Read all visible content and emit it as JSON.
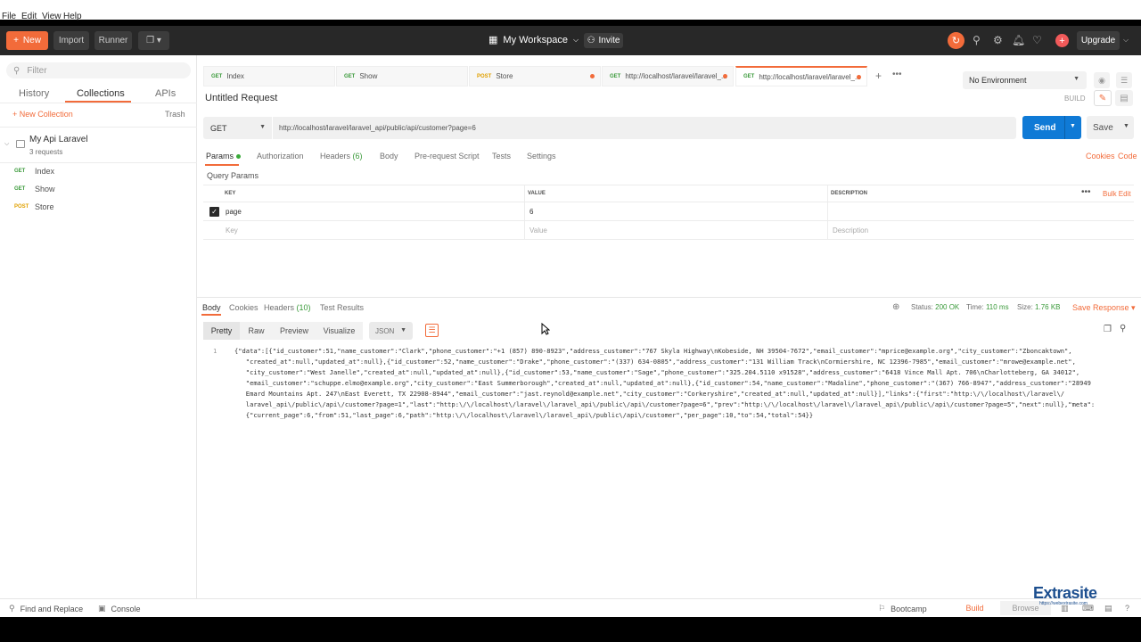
{
  "menubar": {
    "file": "File",
    "edit": "Edit",
    "view": "View",
    "help": "Help"
  },
  "topbar": {
    "new_label": "New",
    "import_label": "Import",
    "runner_label": "Runner",
    "workspace_label": "My Workspace",
    "invite_label": "Invite",
    "upgrade_label": "Upgrade"
  },
  "sidebar": {
    "filter_placeholder": "Filter",
    "tabs": [
      {
        "label": "History"
      },
      {
        "label": "Collections"
      },
      {
        "label": "APIs"
      }
    ],
    "new_collection_label": "+ New Collection",
    "trash_label": "Trash",
    "collection": {
      "name": "My Api Laravel",
      "count": "3 requests"
    },
    "requests": [
      {
        "method": "GET",
        "name": "Index"
      },
      {
        "method": "GET",
        "name": "Show"
      },
      {
        "method": "POST",
        "name": "Store"
      }
    ]
  },
  "tabs": [
    {
      "method": "GET",
      "label": "Index"
    },
    {
      "method": "GET",
      "label": "Show"
    },
    {
      "method": "POST",
      "label": "Store"
    },
    {
      "method": "GET",
      "label": "http://localhost/laravel/laravel_..."
    },
    {
      "method": "GET",
      "label": "http://localhost/laravel/laravel_..."
    }
  ],
  "environment": {
    "selected": "No Environment"
  },
  "request": {
    "title": "Untitled Request",
    "build_label": "BUILD",
    "method": "GET",
    "url": "http://localhost/laravel/laravel_api/public/api/customer?page=6",
    "send_label": "Send",
    "save_label": "Save"
  },
  "param_tabs": [
    {
      "label": "Params"
    },
    {
      "label": "Authorization"
    },
    {
      "label": "Headers",
      "count": "(6)"
    },
    {
      "label": "Body"
    },
    {
      "label": "Pre-request Script"
    },
    {
      "label": "Tests"
    },
    {
      "label": "Settings"
    }
  ],
  "links": {
    "cookies": "Cookies",
    "code": "Code"
  },
  "query_params": {
    "title": "Query Params",
    "headers": {
      "key": "KEY",
      "value": "VALUE",
      "description": "DESCRIPTION"
    },
    "bulk_edit": "Bulk Edit",
    "row": {
      "key": "page",
      "value": "6"
    },
    "placeholders": {
      "key": "Key",
      "value": "Value",
      "description": "Description"
    }
  },
  "response": {
    "tabs": [
      {
        "label": "Body"
      },
      {
        "label": "Cookies"
      },
      {
        "label": "Headers",
        "count": "(10)"
      },
      {
        "label": "Test Results"
      }
    ],
    "status_label": "Status:",
    "status_value": "200 OK",
    "time_label": "Time:",
    "time_value": "110 ms",
    "size_label": "Size:",
    "size_value": "1.76 KB",
    "save_response": "Save Response",
    "format_buttons": [
      {
        "label": "Pretty"
      },
      {
        "label": "Raw"
      },
      {
        "label": "Preview"
      },
      {
        "label": "Visualize"
      }
    ],
    "format_select": "JSON",
    "line_number": "1",
    "body_lines": [
      "{\"data\":[{\"id_customer\":51,\"name_customer\":\"Clark\",\"phone_customer\":\"+1 (857) 890-8923\",\"address_customer\":\"767 Skyla Highway\\nKobeside, NH 39504-7672\",\"email_customer\":\"mprice@example.org\",\"city_customer\":\"Zboncaktown\",",
      "   \"created_at\":null,\"updated_at\":null},{\"id_customer\":52,\"name_customer\":\"Drake\",\"phone_customer\":\"(337) 634-0805\",\"address_customer\":\"131 William Track\\nCormiershire, NC 12396-7985\",\"email_customer\":\"mrowe@example.net\",",
      "   \"city_customer\":\"West Janelle\",\"created_at\":null,\"updated_at\":null},{\"id_customer\":53,\"name_customer\":\"Sage\",\"phone_customer\":\"325.204.5110 x91528\",\"address_customer\":\"6418 Vince Mall Apt. 706\\nCharlotteberg, GA 34012\",",
      "   \"email_customer\":\"schuppe.elmo@example.org\",\"city_customer\":\"East Summerborough\",\"created_at\":null,\"updated_at\":null},{\"id_customer\":54,\"name_customer\":\"Madaline\",\"phone_customer\":\"(367) 766-8947\",\"address_customer\":\"28949",
      "   Emard Mountains Apt. 247\\nEast Everett, TX 22908-8944\",\"email_customer\":\"jast.reynold@example.net\",\"city_customer\":\"Corkeryshire\",\"created_at\":null,\"updated_at\":null}],\"links\":{\"first\":\"http:\\/\\/localhost\\/laravel\\/",
      "   laravel_api\\/public\\/api\\/customer?page=1\",\"last\":\"http:\\/\\/localhost\\/laravel\\/laravel_api\\/public\\/api\\/customer?page=6\",\"prev\":\"http:\\/\\/localhost\\/laravel\\/laravel_api\\/public\\/api\\/customer?page=5\",\"next\":null},\"meta\":",
      "   {\"current_page\":6,\"from\":51,\"last_page\":6,\"path\":\"http:\\/\\/localhost\\/laravel\\/laravel_api\\/public\\/api\\/customer\",\"per_page\":10,\"to\":54,\"total\":54}}"
    ]
  },
  "footer": {
    "find_replace": "Find and Replace",
    "console": "Console",
    "bootcamp": "Bootcamp",
    "build": "Build",
    "browse": "Browse"
  },
  "watermark": {
    "name": "Extrasite",
    "url": "https://webextrasite.com"
  },
  "colors": {
    "accent": "#f26b3a",
    "send": "#0f7ad6",
    "get": "#3a9a3a",
    "post": "#e0a000"
  }
}
